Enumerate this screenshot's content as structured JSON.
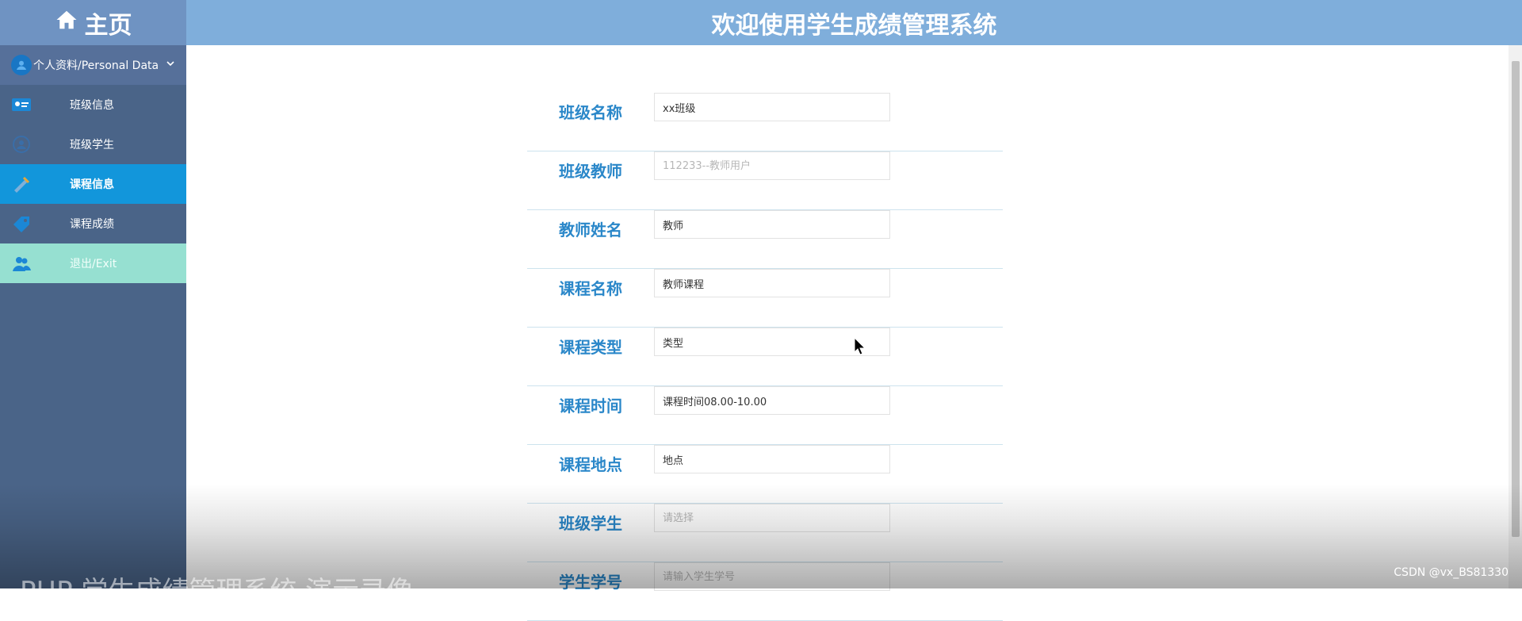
{
  "sidebar": {
    "brand": "主页",
    "section_title": "个人资料/Personal Data",
    "items": [
      {
        "label": "班级信息",
        "icon": "id-card-icon"
      },
      {
        "label": "班级学生",
        "icon": "group-icon"
      },
      {
        "label": "课程信息",
        "icon": "pencil-ruler-icon",
        "active": true
      },
      {
        "label": "课程成绩",
        "icon": "tag-icon"
      },
      {
        "label": "退出/Exit",
        "icon": "users-icon"
      }
    ]
  },
  "header": {
    "title": "欢迎使用学生成绩管理系统"
  },
  "form": {
    "fields": [
      {
        "label": "班级名称",
        "value": "xx班级",
        "placeholder": ""
      },
      {
        "label": "班级教师",
        "value": "",
        "placeholder": "112233--教师用户"
      },
      {
        "label": "教师姓名",
        "value": "教师",
        "placeholder": ""
      },
      {
        "label": "课程名称",
        "value": "教师课程",
        "placeholder": ""
      },
      {
        "label": "课程类型",
        "value": "类型",
        "placeholder": ""
      },
      {
        "label": "课程时间",
        "value": "课程时间08.00-10.00",
        "placeholder": ""
      },
      {
        "label": "课程地点",
        "value": "地点",
        "placeholder": ""
      },
      {
        "label": "班级学生",
        "value": "",
        "placeholder": "请选择"
      },
      {
        "label": "学生学号",
        "value": "",
        "placeholder": "请输入学生学号"
      }
    ]
  },
  "overlay": {
    "caption": "PHP 学生成绩管理系统 演示录像",
    "watermark": "CSDN @vx_BS81330"
  },
  "colors": {
    "sidebar_bg": "#4a6488",
    "header_bg": "#7faedb",
    "active_item": "#1296db",
    "exit_item": "#96e0d1",
    "label_text": "#2a87c9"
  }
}
